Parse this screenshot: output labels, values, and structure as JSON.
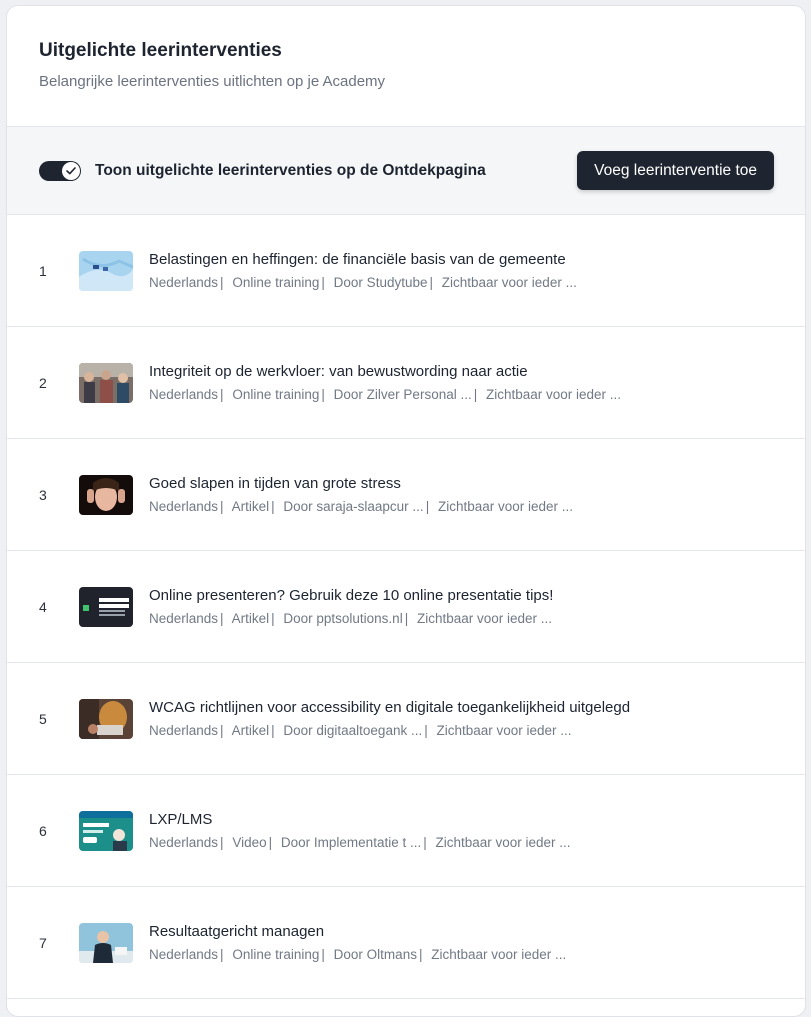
{
  "header": {
    "title": "Uitgelichte leerinterventies",
    "subtitle": "Belangrijke leerinterventies uitlichten op je Academy"
  },
  "toolbar": {
    "toggle_label": "Toon uitgelichte leerinterventies op de Ontdekpagina",
    "toggle_on": true,
    "add_label": "Voeg leerinterventie toe"
  },
  "items": [
    {
      "rank": "1",
      "title": "Belastingen en heffingen: de financiële basis van de gemeente",
      "language": "Nederlands",
      "type": "Online training",
      "author": "Door Studytube",
      "visibility": "Zichtbaar voor ieder ...",
      "thumb": "blue-fabric"
    },
    {
      "rank": "2",
      "title": "Integriteit op de werkvloer: van bewustwording naar actie",
      "language": "Nederlands",
      "type": "Online training",
      "author": "Door Zilver Personal ...",
      "visibility": "Zichtbaar voor ieder ...",
      "thumb": "people-meeting"
    },
    {
      "rank": "3",
      "title": "Goed slapen in tijden van grote stress",
      "language": "Nederlands",
      "type": "Artikel",
      "author": "Door saraja-slaapcur ...",
      "visibility": "Zichtbaar voor ieder ...",
      "thumb": "stressed-person"
    },
    {
      "rank": "4",
      "title": "Online presenteren? Gebruik deze 10 online presentatie tips!",
      "language": "Nederlands",
      "type": "Artikel",
      "author": "Door pptsolutions.nl",
      "visibility": "Zichtbaar voor ieder ...",
      "thumb": "online-presenteren-banner"
    },
    {
      "rank": "5",
      "title": "WCAG richtlijnen voor accessibility en digitale toegankelijkheid uitgelegd",
      "language": "Nederlands",
      "type": "Artikel",
      "author": "Door digitaaltoegank ...",
      "visibility": "Zichtbaar voor ieder ...",
      "thumb": "laptop-person"
    },
    {
      "rank": "6",
      "title": "LXP/LMS",
      "language": "Nederlands",
      "type": "Video",
      "author": "Door Implementatie t ...",
      "visibility": "Zichtbaar voor ieder ...",
      "thumb": "platform-screenshot"
    },
    {
      "rank": "7",
      "title": "Resultaatgericht managen",
      "language": "Nederlands",
      "type": "Online training",
      "author": "Door Oltmans",
      "visibility": "Zichtbaar voor ieder ...",
      "thumb": "manager-desk"
    }
  ],
  "colors": {
    "primary_dark": "#1e2531",
    "text_muted": "#717985",
    "divider": "#e3e6ea",
    "toolbar_bg": "#f5f6f8"
  }
}
